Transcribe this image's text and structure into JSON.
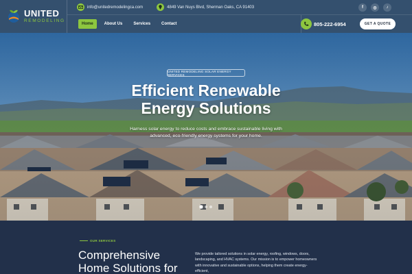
{
  "brand": {
    "name_line1": "UNITED",
    "name_line2": "REMODELING"
  },
  "topbar": {
    "email": "info@unitedremodelingca.com",
    "address": "4849 Van Nuys Blvd, Sherman Oaks, CA 91403",
    "socials": [
      {
        "icon": "facebook-icon",
        "glyph": "f"
      },
      {
        "icon": "instagram-icon",
        "glyph": "◎"
      },
      {
        "icon": "tiktok-icon",
        "glyph": "♪"
      }
    ]
  },
  "nav": {
    "items": [
      {
        "label": "Home",
        "active": true
      },
      {
        "label": "About Us",
        "active": false
      },
      {
        "label": "Services",
        "active": false
      },
      {
        "label": "Contact",
        "active": false
      }
    ],
    "phone": "805-222-6954",
    "cta": "GET A QUOTE"
  },
  "hero": {
    "badge": "UNITED REMODELING SOLAR ENERGY SERVICES",
    "title_line1": "Efficient Renewable",
    "title_line2": "Energy Solutions",
    "subtitle": "Harness solar energy to reduce costs and embrace sustainable living with advanced, eco-friendly energy systems for your home.",
    "slides": 3,
    "active_slide": 1
  },
  "services": {
    "tag": "OUR SERVICES",
    "title_line1": "Comprehensive",
    "title_line2": "Home Solutions for",
    "text": "We provide tailored solutions in solar energy, roofing, windows, doors, landscaping, and HVAC systems. Our mission is to empower homeowners with innovative and sustainable options, helping them create energy-efficient,"
  },
  "colors": {
    "header_bg": "#34506e",
    "accent_green": "#8dc63f",
    "section_bg": "#22304a",
    "logo_blue": "#1f5d9c",
    "logo_orange": "#f08a24"
  }
}
